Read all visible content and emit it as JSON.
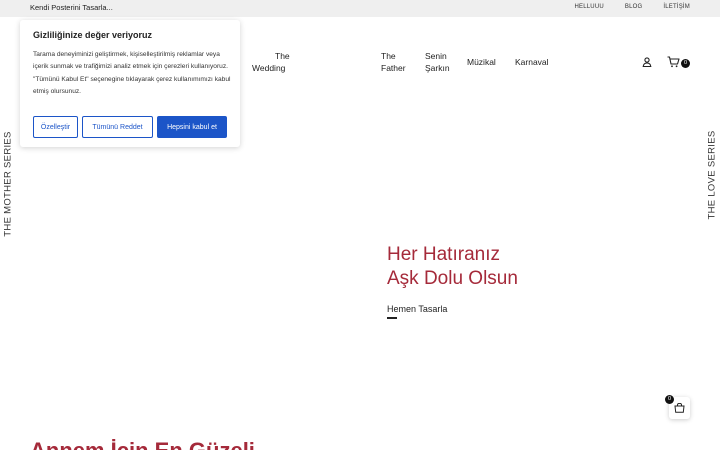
{
  "topbar": {
    "promo": "Kendi Posterini Tasarla...",
    "links": [
      "HELLUUU",
      "BLOG",
      "İLETİŞİM"
    ]
  },
  "nav": {
    "items": [
      {
        "line1": "The",
        "line2": "Wedding"
      },
      {
        "line1": "The",
        "line2": "Father"
      },
      {
        "line1": "Senin",
        "line2": "Şarkın"
      },
      {
        "line1": "Müzikal",
        "line2": ""
      },
      {
        "line1": "Karnaval",
        "line2": ""
      }
    ],
    "cart_count": "0"
  },
  "side": {
    "left": "THE MOTHER SERIES",
    "right": "THE LOVE SERIES"
  },
  "hero": {
    "title_line1": "Her Hatıranız",
    "title_line2": "Aşk Dolu Olsun",
    "cta": "Hemen Tasarla"
  },
  "section": {
    "title": "Annem İçin En Güzeli"
  },
  "cookie": {
    "title": "Gizliliğinize değer veriyoruz",
    "text": "Tarama deneyiminizi geliştirmek, kişiselleştirilmiş reklamlar veya içerik sunmak ve trafiğimizi analiz etmek için çerezleri kullanıyoruz. \"Tümünü Kabul Et\" seçenegine tıklayarak çerez kullanımımızı kabul etmiş olursunuz.",
    "customize": "Özelleştir",
    "reject": "Tümünü Reddet",
    "accept": "Hepsini kabul et"
  },
  "floating_cart": {
    "count": "0"
  },
  "colors": {
    "accent": "#a52a3a",
    "button_blue": "#1c55c8",
    "topbar_bg": "#efefef"
  }
}
